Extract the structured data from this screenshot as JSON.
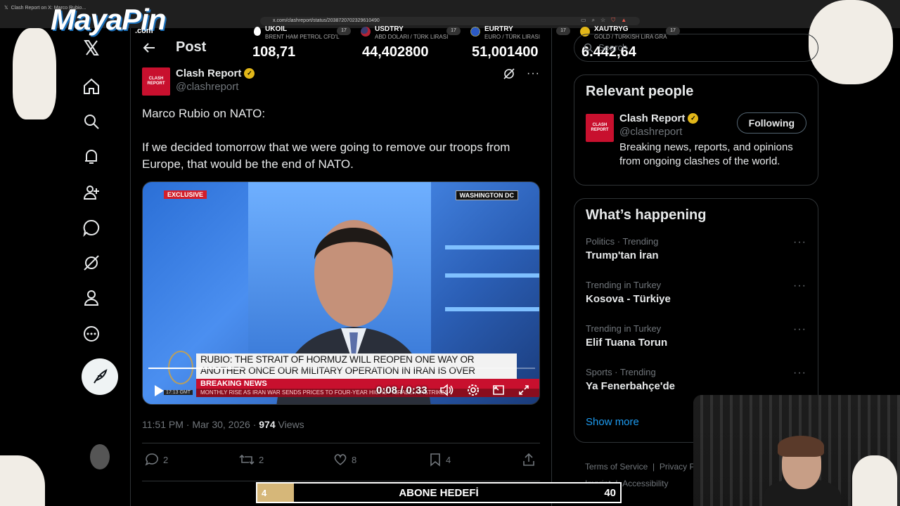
{
  "browser": {
    "tab_title": "Clash Report on X: Marco Rubio...",
    "url": "x.com/clashreport/status/2038720702329610490"
  },
  "overlay_logo": {
    "name": "MayaPin",
    "suffix": ".com"
  },
  "ticker": [
    {
      "symbol": "UKOIL",
      "subtitle": "BRENT HAM PETROL CFD'L",
      "value": "108,71",
      "icon_color": "#ffffff"
    },
    {
      "symbol": "USDTRY",
      "subtitle": "ABD DOLARI / TÜRK LIRASI",
      "value": "44,402800",
      "icon_color": "#b22234"
    },
    {
      "symbol": "EURTRY",
      "subtitle": "EURO / TÜRK LIRASI",
      "value": "51,001400",
      "icon_color": "#2b59c3"
    },
    {
      "symbol": "XAUTRYG",
      "subtitle": "GOLD / TURKISH LIRA GRA",
      "value": "6.442,64",
      "icon_color": "#e2b719"
    }
  ],
  "nav": {
    "items": [
      "x-logo-icon",
      "home-icon",
      "search-icon",
      "notifications-icon",
      "follow-icon",
      "messages-icon",
      "grok-icon",
      "profile-icon",
      "more-icon"
    ]
  },
  "post": {
    "header_title": "Post",
    "author_name": "Clash Report",
    "author_handle": "@clashreport",
    "avatar_text": "CLASH REPORT",
    "text_line1": "Marco Rubio on NATO:",
    "text_line2": "If we decided tomorrow that we were going to remove our troops from Europe, that would be the end of NATO.",
    "video": {
      "exclusive_label": "EXCLUSIVE",
      "location_label": "WASHINGTON DC",
      "caption": "RUBIO: THE STRAIT OF HORMUZ WILL REOPEN ONE WAY OR ANOTHER ONCE OUR MILITARY OPERATION IN IRAN IS OVER",
      "breaking_label": "BREAKING NEWS",
      "ticker_text": "MONTHLY RISE AS IRAN WAR SENDS PRICES TO FOUR-YEAR HIGHS  •  ISRAELI AIRSTRIKES",
      "clock": "17:13 GMT",
      "time": "0:08 / 0:33",
      "progress": 0.24
    },
    "timestamp": "11:51 PM · Mar 30, 2026 · ",
    "views_count": "974",
    "views_label": " Views",
    "actions": {
      "replies": "2",
      "reposts": "2",
      "likes": "8",
      "bookmarks": "4"
    }
  },
  "sidebar": {
    "search_placeholder": "Search",
    "relevant_title": "Relevant people",
    "person": {
      "name": "Clash Report",
      "handle": "@clashreport",
      "bio": "Breaking news, reports, and opinions from ongoing clashes of the world.",
      "follow_label": "Following"
    },
    "happening_title": "What’s happening",
    "trends": [
      {
        "category": "Politics · Trending",
        "name": "Trump'tan İran"
      },
      {
        "category": "Trending in Turkey",
        "name": "Kosova - Türkiye"
      },
      {
        "category": "Trending in Turkey",
        "name": "Elif Tuana Torun"
      },
      {
        "category": "Sports · Trending",
        "name": "Ya Fenerbahçe'de"
      }
    ],
    "show_more": "Show more",
    "footer": {
      "terms": "Terms of Service",
      "privacy": "Privacy P",
      "imprint": "Imprint",
      "accessibility": "Accessibility"
    }
  },
  "sub_goal": {
    "current": "4",
    "title": "ABONE HEDEFİ",
    "target": "40",
    "progress": 0.1
  },
  "colors": {
    "accent": "#1d9bf0",
    "text": "#e7e9ea",
    "muted": "#71767b",
    "border": "#2f3336",
    "verified": "#e2b719"
  }
}
